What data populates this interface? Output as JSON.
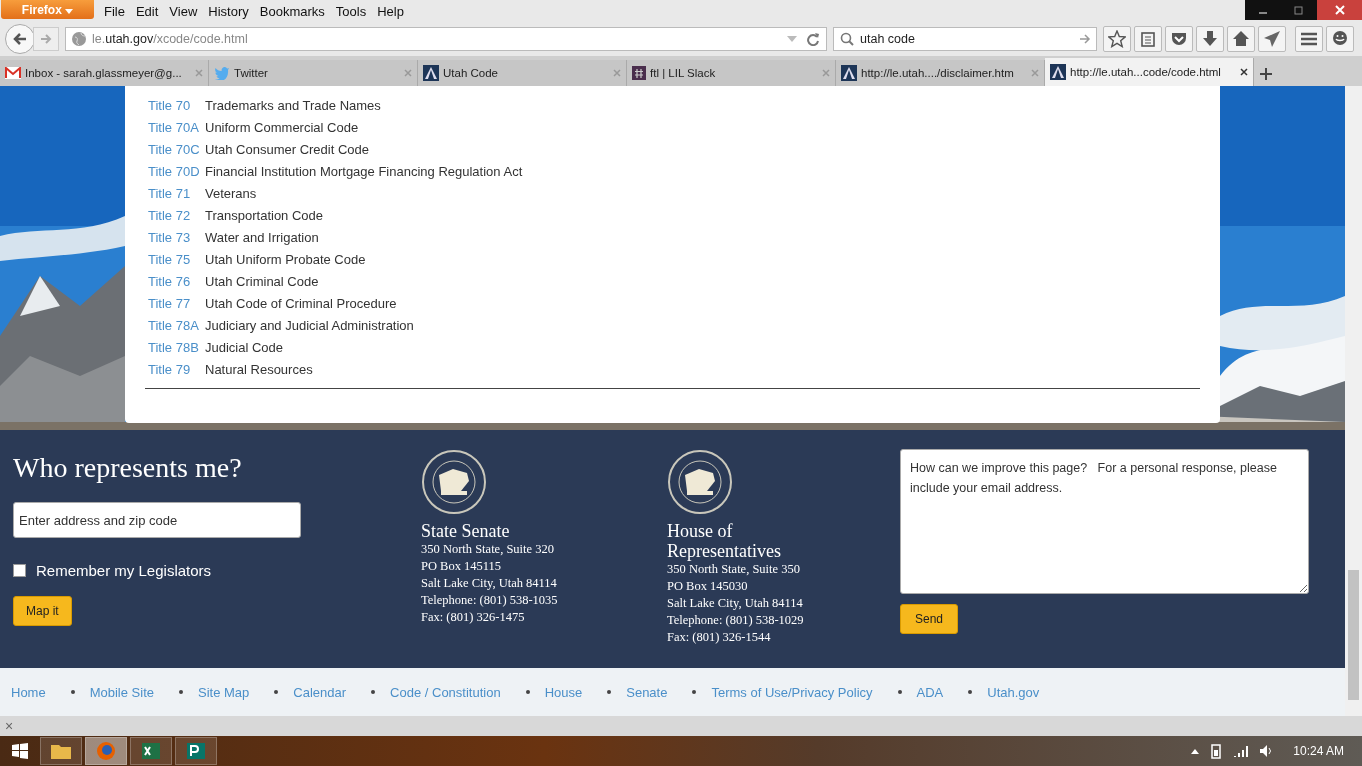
{
  "browser": {
    "app_button": "Firefox",
    "menu": [
      "File",
      "Edit",
      "View",
      "History",
      "Bookmarks",
      "Tools",
      "Help"
    ],
    "url": "le.**utah.gov**/xcode/code.html",
    "search": "utah code",
    "tabs": [
      {
        "kind": "mail",
        "label": "Inbox - sarah.glassmeyer@g...",
        "selected": false
      },
      {
        "kind": "bird",
        "label": "Twitter",
        "selected": false
      },
      {
        "kind": "capitol",
        "label": "Utah Code",
        "selected": false
      },
      {
        "kind": "hash",
        "label": "ftl | LIL Slack",
        "selected": false
      },
      {
        "kind": "capitol",
        "label": "http://le.utah..../disclaimer.htm",
        "selected": false
      },
      {
        "kind": "capitol",
        "label": "http://le.utah...code/code.html",
        "selected": true
      }
    ]
  },
  "titles": [
    {
      "number": "Title 70",
      "name": "Trademarks and Trade Names"
    },
    {
      "number": "Title 70A",
      "name": "Uniform Commercial Code"
    },
    {
      "number": "Title 70C",
      "name": "Utah Consumer Credit Code"
    },
    {
      "number": "Title 70D",
      "name": "Financial Institution Mortgage Financing Regulation Act"
    },
    {
      "number": "Title 71",
      "name": "Veterans"
    },
    {
      "number": "Title 72",
      "name": "Transportation Code"
    },
    {
      "number": "Title 73",
      "name": "Water and Irrigation"
    },
    {
      "number": "Title 75",
      "name": "Utah Uniform Probate Code"
    },
    {
      "number": "Title 76",
      "name": "Utah Criminal Code"
    },
    {
      "number": "Title 77",
      "name": "Utah Code of Criminal Procedure"
    },
    {
      "number": "Title 78A",
      "name": "Judiciary and Judicial Administration"
    },
    {
      "number": "Title 78B",
      "name": "Judicial Code"
    },
    {
      "number": "Title 79",
      "name": "Natural Resources"
    }
  ],
  "footer": {
    "heading": "Who represents me?",
    "address_placeholder": "Enter address and zip code",
    "remember": {
      "label": "Remember my Legislators",
      "checked": false
    },
    "map_button": "Map it",
    "chambers": [
      {
        "name": "State Senate",
        "lines": [
          "350 North State, Suite 320",
          "PO Box 145115",
          "Salt Lake City, Utah 84114",
          "Telephone: (801) 538-1035",
          "Fax: (801) 326-1475"
        ]
      },
      {
        "name": "House of Representatives",
        "lines": [
          "350 North State, Suite 350",
          "PO Box 145030",
          "Salt Lake City, Utah 84114",
          "Telephone: (801) 538-1029",
          "Fax: (801) 326-1544"
        ]
      }
    ],
    "feedback_placeholder": "How can we improve this page?   For a personal response, please include your email address.",
    "send_button": "Send"
  },
  "links": [
    "Home",
    "Mobile Site",
    "Site Map",
    "Calendar",
    "Code / Constitution",
    "House",
    "Senate",
    "Terms of Use/Privacy Policy",
    "ADA",
    "Utah.gov"
  ],
  "bar_close": "×",
  "taskbar": {
    "apps": [
      {
        "kind": "folder",
        "selected": false
      },
      {
        "kind": "firefox",
        "selected": true
      },
      {
        "kind": "excel",
        "selected": false
      },
      {
        "kind": "publisher",
        "selected": false
      }
    ],
    "time": "10:24 AM"
  }
}
